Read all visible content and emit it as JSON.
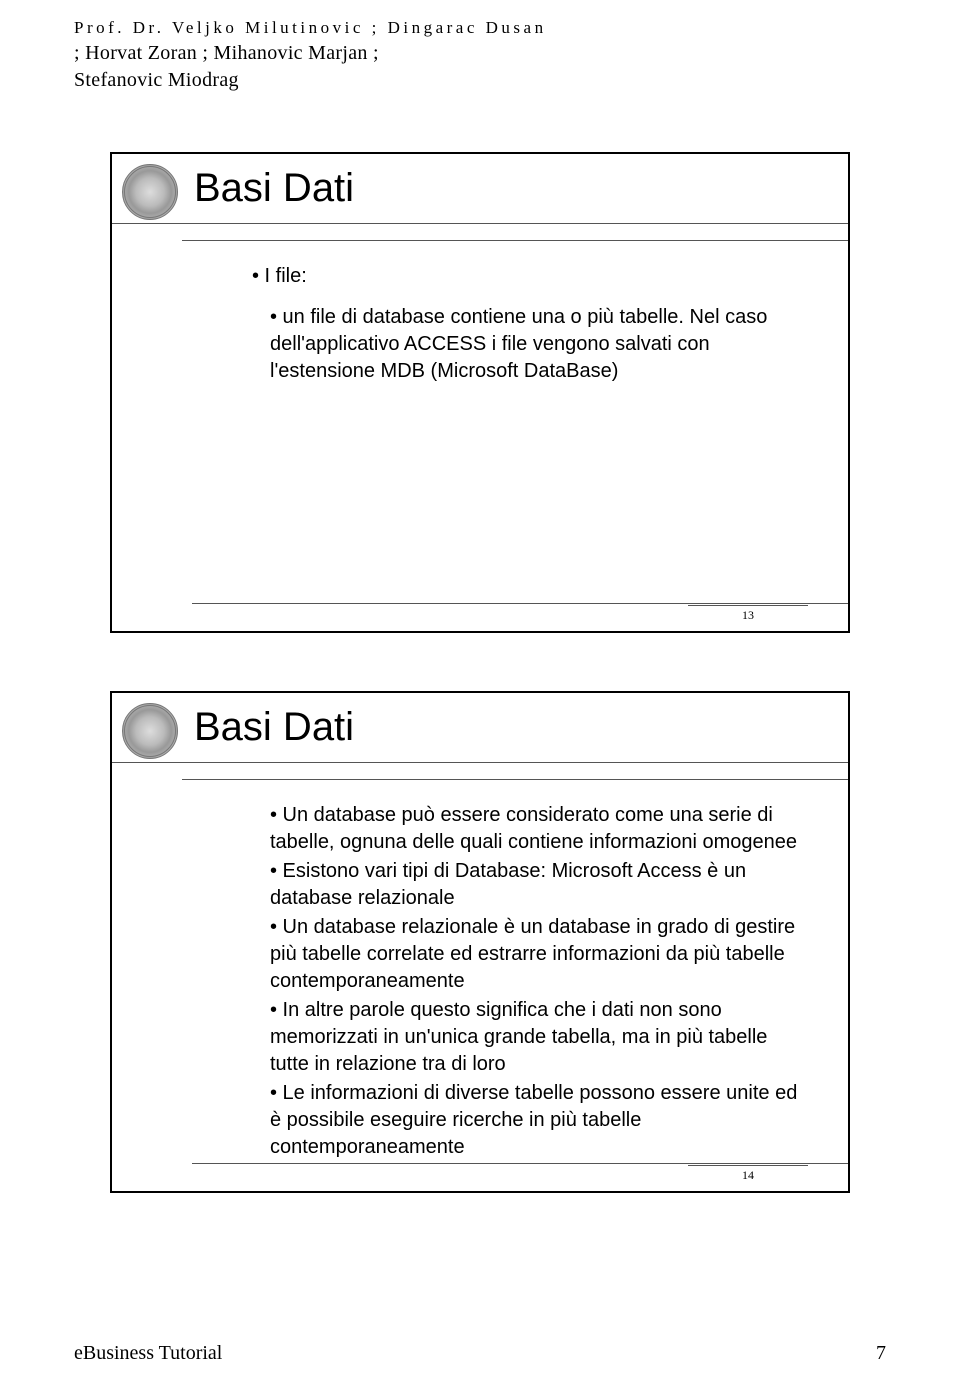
{
  "header": {
    "line1": "Prof. Dr. Veljko Milutinovic ; Dingarac Dusan",
    "line2": "; Horvat Zoran ; Mihanovic Marjan ;",
    "line3": "Stefanovic Miodrag"
  },
  "slides": [
    {
      "number": "13",
      "title": "Basi Dati",
      "items": [
        {
          "level": 1,
          "text": "• I file:"
        },
        {
          "level": 2,
          "text": "• un file di database contiene una o più tabelle. Nel caso dell'applicativo ACCESS i file vengono salvati con l'estensione MDB (Microsoft DataBase)"
        }
      ]
    },
    {
      "number": "14",
      "title": "Basi Dati",
      "items": [
        {
          "level": 2,
          "text": "• Un database può essere considerato come una serie di tabelle, ognuna delle quali contiene informazioni omogenee"
        },
        {
          "level": 2,
          "text": "• Esistono vari tipi di Database: Microsoft Access è un database relazionale"
        },
        {
          "level": 2,
          "text": "• Un database relazionale è un database in grado di gestire più tabelle correlate ed estrarre informazioni da più tabelle contemporaneamente"
        },
        {
          "level": 2,
          "text": "• In altre parole questo significa che i dati non sono memorizzati in un'unica grande tabella, ma in più tabelle tutte in relazione tra di loro"
        },
        {
          "level": 2,
          "text": "• Le informazioni di diverse tabelle possono essere unite ed è possibile eseguire ricerche in più tabelle contemporaneamente"
        }
      ]
    }
  ],
  "footer": {
    "left": "eBusiness Tutorial",
    "right": "7"
  }
}
